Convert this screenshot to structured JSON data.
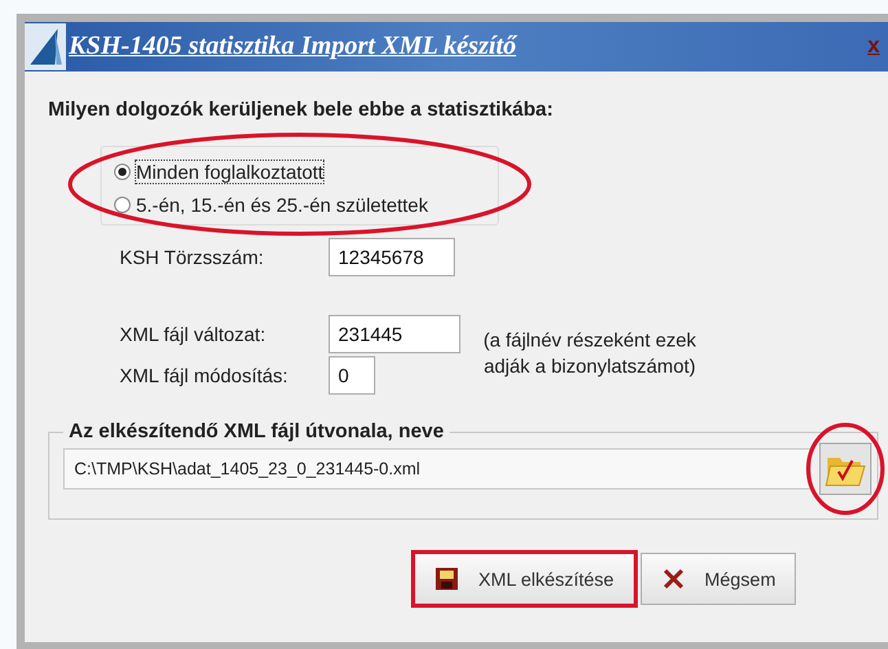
{
  "window": {
    "title": "KSH-1405 statisztika Import XML készítő",
    "close": "x"
  },
  "question": "Milyen dolgozók kerüljenek bele ebbe a statisztikába:",
  "radio_group": {
    "highlighted": true,
    "options": [
      {
        "label": "Minden foglalkoztatott",
        "selected": true
      },
      {
        "label": "5.-én, 15.-én és 25.-én születettek",
        "selected": false
      }
    ]
  },
  "ksh_number": {
    "label": "KSH Törzsszám:",
    "value": "12345678"
  },
  "xml_version": {
    "label": "XML fájl változat:",
    "value": "231445"
  },
  "xml_modification": {
    "label": "XML fájl módosítás:",
    "value": "0"
  },
  "note": "(a fájlnév részeként ezek adják a bizonylatszámot)",
  "output": {
    "legend": "Az elkészítendő XML fájl útvonala, neve",
    "path": "C:\\TMP\\KSH\\adat_1405_23_0_231445-0.xml",
    "browse_highlighted": true
  },
  "buttons": [
    {
      "kind": "save",
      "label": "XML elkészítése",
      "highlighted": true
    },
    {
      "kind": "cancel",
      "label": "Mégsem",
      "highlighted": false
    }
  ]
}
